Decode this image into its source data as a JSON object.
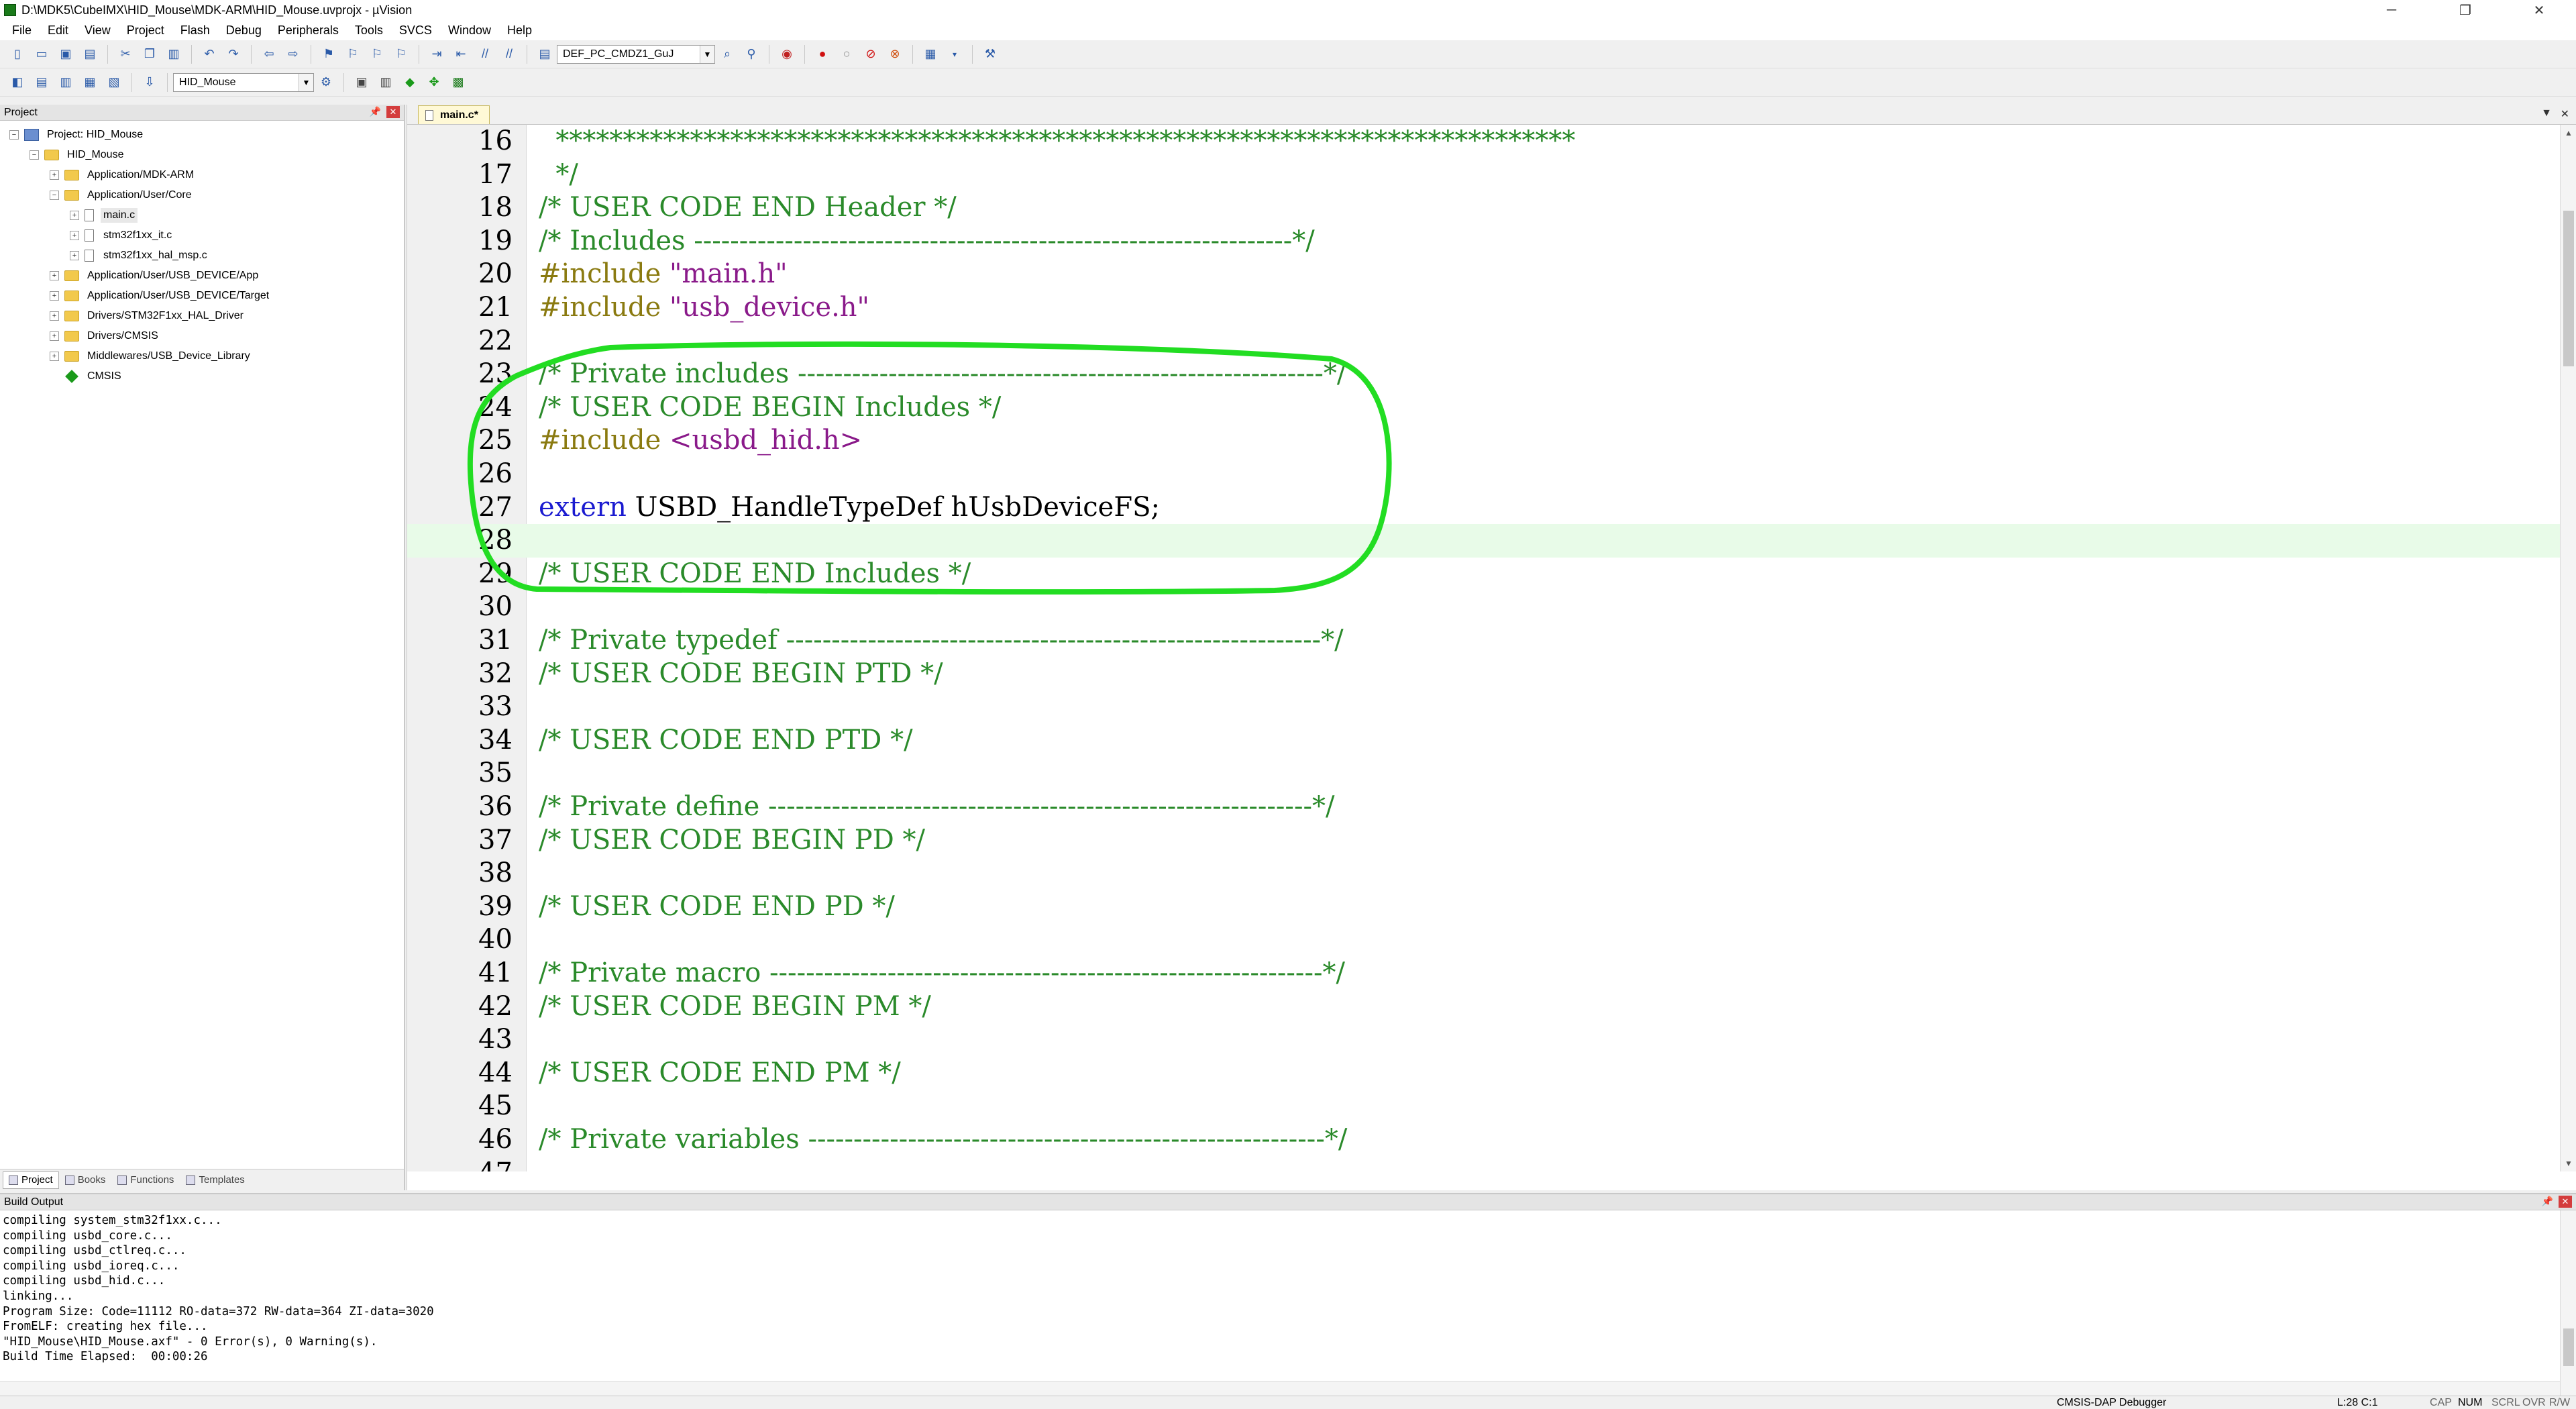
{
  "window": {
    "title": "D:\\MDK5\\CubeIMX\\HID_Mouse\\MDK-ARM\\HID_Mouse.uvprojx - µVision",
    "minimize": "─",
    "maximize": "❐",
    "close": "✕"
  },
  "menu": [
    "File",
    "Edit",
    "View",
    "Project",
    "Flash",
    "Debug",
    "Peripherals",
    "Tools",
    "SVCS",
    "Window",
    "Help"
  ],
  "toolbar": {
    "target_combo": "DEF_PC_CMDZ1_GuJ",
    "project_target": "HID_Mouse"
  },
  "project_panel": {
    "header": "Project",
    "tree": [
      {
        "label": "Project: HID_Mouse",
        "type": "project",
        "level": 0,
        "expander": "−"
      },
      {
        "label": "HID_Mouse",
        "type": "target",
        "level": 1,
        "expander": "−"
      },
      {
        "label": "Application/MDK-ARM",
        "type": "folder",
        "level": 2,
        "expander": "+"
      },
      {
        "label": "Application/User/Core",
        "type": "folder",
        "level": 2,
        "expander": "−"
      },
      {
        "label": "main.c",
        "type": "file",
        "level": 3,
        "expander": "+",
        "selected": true
      },
      {
        "label": "stm32f1xx_it.c",
        "type": "file",
        "level": 3,
        "expander": "+"
      },
      {
        "label": "stm32f1xx_hal_msp.c",
        "type": "file",
        "level": 3,
        "expander": "+"
      },
      {
        "label": "Application/User/USB_DEVICE/App",
        "type": "folder",
        "level": 2,
        "expander": "+"
      },
      {
        "label": "Application/User/USB_DEVICE/Target",
        "type": "folder",
        "level": 2,
        "expander": "+"
      },
      {
        "label": "Drivers/STM32F1xx_HAL_Driver",
        "type": "folder",
        "level": 2,
        "expander": "+"
      },
      {
        "label": "Drivers/CMSIS",
        "type": "folder",
        "level": 2,
        "expander": "+"
      },
      {
        "label": "Middlewares/USB_Device_Library",
        "type": "folder",
        "level": 2,
        "expander": "+"
      },
      {
        "label": "CMSIS",
        "type": "component",
        "level": 2,
        "expander": ""
      }
    ],
    "tabs": [
      "Project",
      "Books",
      "Functions",
      "Templates"
    ]
  },
  "editor": {
    "tab_label": "main.c*",
    "current_line": 28,
    "lines": [
      {
        "n": "16",
        "segs": [
          {
            "t": "  ****************************************************************************",
            "c": "comment"
          }
        ]
      },
      {
        "n": "17",
        "segs": [
          {
            "t": "  */",
            "c": "comment"
          }
        ]
      },
      {
        "n": "18",
        "segs": [
          {
            "t": "/* USER CODE END Header */",
            "c": "comment"
          }
        ]
      },
      {
        "n": "19",
        "segs": [
          {
            "t": "/* Includes ------------------------------------------------------------------*/",
            "c": "comment"
          }
        ]
      },
      {
        "n": "20",
        "segs": [
          {
            "t": "#include ",
            "c": "pp"
          },
          {
            "t": "\"main.h\"",
            "c": "str"
          }
        ]
      },
      {
        "n": "21",
        "segs": [
          {
            "t": "#include ",
            "c": "pp"
          },
          {
            "t": "\"usb_device.h\"",
            "c": "str"
          }
        ]
      },
      {
        "n": "22",
        "segs": []
      },
      {
        "n": "23",
        "segs": [
          {
            "t": "/* Private includes ----------------------------------------------------------*/",
            "c": "comment"
          }
        ]
      },
      {
        "n": "24",
        "segs": [
          {
            "t": "/* USER CODE BEGIN Includes */",
            "c": "comment"
          }
        ]
      },
      {
        "n": "25",
        "segs": [
          {
            "t": "#include ",
            "c": "pp"
          },
          {
            "t": "<usbd_hid.h>",
            "c": "str"
          }
        ]
      },
      {
        "n": "26",
        "segs": []
      },
      {
        "n": "27",
        "segs": [
          {
            "t": "extern",
            "c": "kw"
          },
          {
            "t": " USBD_HandleTypeDef hUsbDeviceFS;",
            "c": "plain"
          }
        ]
      },
      {
        "n": "28",
        "segs": []
      },
      {
        "n": "29",
        "segs": [
          {
            "t": "/* USER CODE END Includes */",
            "c": "comment"
          }
        ]
      },
      {
        "n": "30",
        "segs": []
      },
      {
        "n": "31",
        "segs": [
          {
            "t": "/* Private typedef -----------------------------------------------------------*/",
            "c": "comment"
          }
        ]
      },
      {
        "n": "32",
        "segs": [
          {
            "t": "/* USER CODE BEGIN PTD */",
            "c": "comment"
          }
        ]
      },
      {
        "n": "33",
        "segs": []
      },
      {
        "n": "34",
        "segs": [
          {
            "t": "/* USER CODE END PTD */",
            "c": "comment"
          }
        ]
      },
      {
        "n": "35",
        "segs": []
      },
      {
        "n": "36",
        "segs": [
          {
            "t": "/* Private define ------------------------------------------------------------*/",
            "c": "comment"
          }
        ]
      },
      {
        "n": "37",
        "segs": [
          {
            "t": "/* USER CODE BEGIN PD */",
            "c": "comment"
          }
        ]
      },
      {
        "n": "38",
        "segs": []
      },
      {
        "n": "39",
        "segs": [
          {
            "t": "/* USER CODE END PD */",
            "c": "comment"
          }
        ]
      },
      {
        "n": "40",
        "segs": []
      },
      {
        "n": "41",
        "segs": [
          {
            "t": "/* Private macro -------------------------------------------------------------*/",
            "c": "comment"
          }
        ]
      },
      {
        "n": "42",
        "segs": [
          {
            "t": "/* USER CODE BEGIN PM */",
            "c": "comment"
          }
        ]
      },
      {
        "n": "43",
        "segs": []
      },
      {
        "n": "44",
        "segs": [
          {
            "t": "/* USER CODE END PM */",
            "c": "comment"
          }
        ]
      },
      {
        "n": "45",
        "segs": []
      },
      {
        "n": "46",
        "segs": [
          {
            "t": "/* Private variables ---------------------------------------------------------*/",
            "c": "comment"
          }
        ]
      },
      {
        "n": "47",
        "segs": []
      }
    ]
  },
  "build_output": {
    "header": "Build Output",
    "lines": [
      "compiling system_stm32f1xx.c...",
      "compiling usbd_core.c...",
      "compiling usbd_ctlreq.c...",
      "compiling usbd_ioreq.c...",
      "compiling usbd_hid.c...",
      "linking...",
      "Program Size: Code=11112 RO-data=372 RW-data=364 ZI-data=3020",
      "FromELF: creating hex file...",
      "\"HID_Mouse\\HID_Mouse.axf\" - 0 Error(s), 0 Warning(s).",
      "Build Time Elapsed:  00:00:26"
    ]
  },
  "status_bar": {
    "debugger": "CMSIS-DAP Debugger",
    "position": "L:28 C:1",
    "caps": "CAP",
    "num": "NUM",
    "scrl": "SCRL",
    "ovr": "OVR",
    "rw": "R/W"
  },
  "colors": {
    "comment": "#2a8a2a",
    "preprocessor": "#8a7a10",
    "string": "#8a1a8a",
    "keyword": "#1a1ad0",
    "annotation": "#22dd22",
    "current_line": "#e8fbe8"
  }
}
